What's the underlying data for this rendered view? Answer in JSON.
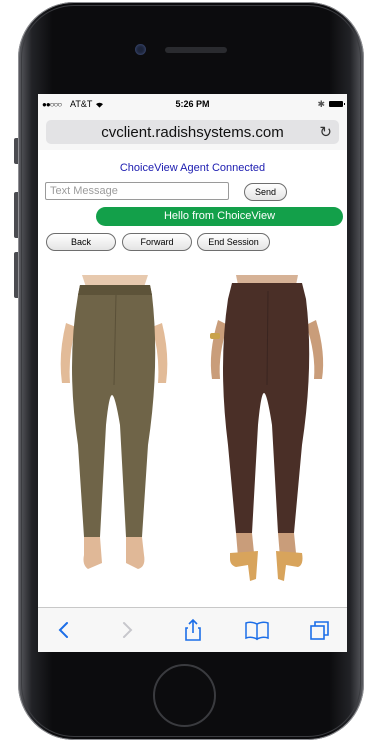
{
  "status_bar": {
    "signal": "●●○○○",
    "carrier": "AT&T",
    "time": "5:26 PM"
  },
  "browser": {
    "url": "cvclient.radishsystems.com",
    "reload_icon": "reload-icon"
  },
  "page": {
    "agent_status": "ChoiceView Agent Connected",
    "message_placeholder": "Text Message",
    "send_label": "Send",
    "hello_message": "Hello from ChoiceView",
    "back_label": "Back",
    "forward_label": "Forward",
    "end_session_label": "End Session",
    "products": [
      {
        "color": "#6f6448",
        "icon": "olive-pants-image"
      },
      {
        "color": "#4a2f27",
        "icon": "brown-pants-image"
      }
    ]
  },
  "toolbar": {
    "items": [
      "back-arrow-icon",
      "forward-arrow-icon",
      "share-icon",
      "bookmarks-icon",
      "tabs-icon"
    ]
  },
  "colors": {
    "accent_blue": "#1c6ee8",
    "hello_green": "#13a04a",
    "agent_text": "#1c1cb0"
  }
}
